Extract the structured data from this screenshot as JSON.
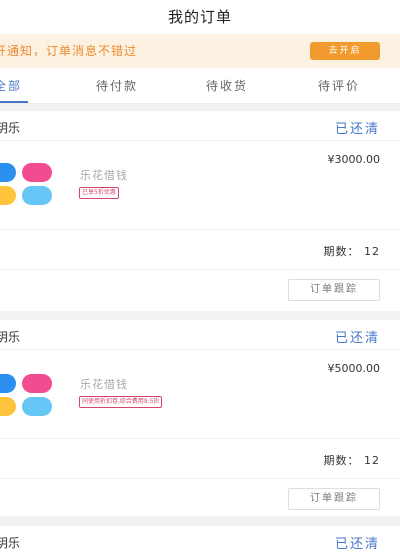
{
  "header": {
    "title": "我的订单"
  },
  "notice": {
    "text": "开通知，订单消息不错过",
    "button_label": "去开启"
  },
  "tabs": [
    {
      "label": "全部",
      "active": true
    },
    {
      "label": "待付款",
      "active": false
    },
    {
      "label": "待收货",
      "active": false
    },
    {
      "label": "待评价",
      "active": false
    }
  ],
  "orders": [
    {
      "merchant": "玥乐",
      "status": "已还清",
      "product_name": "乐花借钱",
      "discount": "已享5折优惠",
      "price": "¥3000.00",
      "period_label": "期数：",
      "period_value": "12",
      "track_label": "订单跟踪"
    },
    {
      "merchant": "玥乐",
      "status": "已还清",
      "product_name": "乐花借钱",
      "discount": "同使用折扣卷,综合费用9.5折",
      "price": "¥5000.00",
      "period_label": "期数：",
      "period_value": "12",
      "track_label": "订单跟踪"
    },
    {
      "merchant": "玥乐",
      "status": "已还清"
    }
  ],
  "colors": {
    "accent": "#4a78c8",
    "notice_bg": "#fdf1e2",
    "notice_text": "#ec8a2e",
    "notice_button": "#f39a2e",
    "badge": "#d4456c",
    "logo": [
      "#2b8ff0",
      "#f14c8f",
      "#ffc43c",
      "#66c6f5"
    ]
  }
}
